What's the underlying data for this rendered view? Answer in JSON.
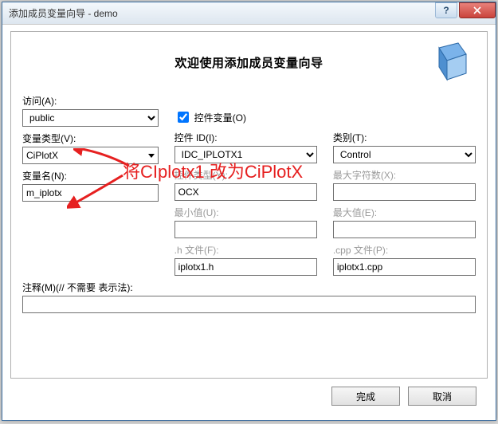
{
  "window": {
    "title": "添加成员变量向导 - demo"
  },
  "banner": {
    "title": "欢迎使用添加成员变量向导"
  },
  "labels": {
    "access": "访问(A):",
    "varType": "变量类型(V):",
    "varName": "变量名(N):",
    "controlVar": "控件变量(O)",
    "controlId": "控件 ID(I):",
    "controlType": "控件类型(Y):",
    "minValue": "最小值(U):",
    "hFile": ".h 文件(F):",
    "category": "类别(T):",
    "maxChars": "最大字符数(X):",
    "maxValue": "最大值(E):",
    "cppFile": ".cpp 文件(P):",
    "comment": "注释(M)(// 不需要 表示法):"
  },
  "values": {
    "access": "public",
    "varType": "CiPlotX",
    "varName": "m_iplotx",
    "controlVarChecked": true,
    "controlId": "IDC_IPLOTX1",
    "controlType": "OCX",
    "hFile": "iplotx1.h",
    "category": "Control",
    "cppFile": "iplotx1.cpp"
  },
  "buttons": {
    "finish": "完成",
    "cancel": "取消"
  },
  "annotation": {
    "text": "将CIplotx1 改为CiPlotX"
  }
}
